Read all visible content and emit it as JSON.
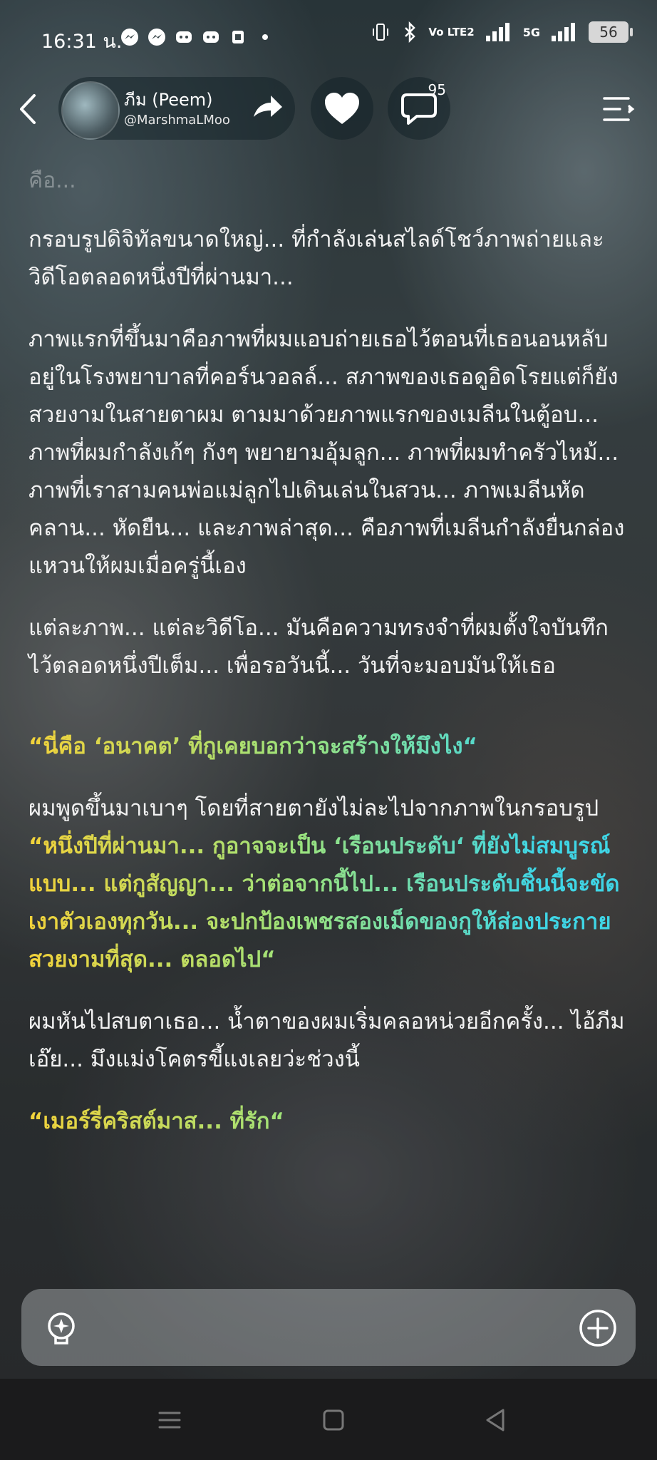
{
  "status_bar": {
    "time": "16:31 น.",
    "network": "Vo LTE2",
    "network2": "5G",
    "battery": "56",
    "icons": [
      "messenger-icon",
      "messenger-icon",
      "discord-icon",
      "discord-icon",
      "sim-icon",
      "dot-icon",
      "vibrate-icon",
      "bluetooth-icon",
      "signal-icon",
      "signal-icon"
    ]
  },
  "header": {
    "author_name": "ภีม (Peem)",
    "author_handle": "@MarshmaLMoo",
    "comment_count": "95"
  },
  "content": {
    "faded_line": "คือ...",
    "p1": "กรอบรูปดิจิทัลขนาดใหญ่... ที่กำลังเล่นสไลด์โชว์ภาพถ่ายและวิดีโอตลอดหนึ่งปีที่ผ่านมา...",
    "p2": "ภาพแรกที่ขึ้นมาคือภาพที่ผมแอบถ่ายเธอไว้ตอนที่เธอนอนหลับอยู่ในโรงพยาบาลที่คอร์นวอลล์... สภาพของเธอดูอิดโรยแต่ก็ยังสวยงามในสายตาผม ตามมาด้วยภาพแรกของเมลีนในตู้อบ... ภาพที่ผมกำลังเก้ๆ กังๆ พยายามอุ้มลูก... ภาพที่ผมทำครัวไหม้... ภาพที่เราสามคนพ่อแม่ลูกไปเดินเล่นในสวน... ภาพเมลีนหัดคลาน... หัดยืน... และภาพล่าสุด... คือภาพที่เมลีนกำลังยื่นกล่องแหวนให้ผมเมื่อครู่นี้เอง",
    "p3": "แต่ละภาพ... แต่ละวิดีโอ... มันคือความทรงจำที่ผมตั้งใจบันทึกไว้ตลอดหนึ่งปีเต็ม... เพื่อรอวันนี้... วันที่จะมอบมันให้เธอ",
    "q1": "“นี่คือ ‘อนาคต’ ที่กูเคยบอกว่าจะสร้างให้มึงไง“",
    "p4": "ผมพูดขึ้นมาเบาๆ โดยที่สายตายังไม่ละไปจากภาพในกรอบรูป",
    "q2": "“หนึ่งปีที่ผ่านมา... กูอาจจะเป็น ‘เรือนประดับ‘ ที่ยังไม่สมบูรณ์แบบ... แต่กูสัญญา... ว่าต่อจากนี้ไป... เรือนประดับชิ้นนี้จะขัดเงาตัวเองทุกวัน... จะปกป้องเพชรสองเม็ดของกูให้ส่องประกายสวยงามที่สุด... ตลอดไป“",
    "p5": "ผมหันไปสบตาเธอ... น้ำตาของผมเริ่มคลอหน่วยอีกครั้ง... ไอ้ภีมเอ๊ย... มึงแม่งโคตรขี้แงเลยว่ะช่วงนี้",
    "q3": "“เมอร์รี่คริสต์มาส... ที่รัก“"
  },
  "bottom": {
    "icons": [
      "lightbulb-icon",
      "plus-circle-icon"
    ]
  },
  "navbar": {
    "icons": [
      "menu-icon",
      "home-icon",
      "back-icon"
    ]
  }
}
